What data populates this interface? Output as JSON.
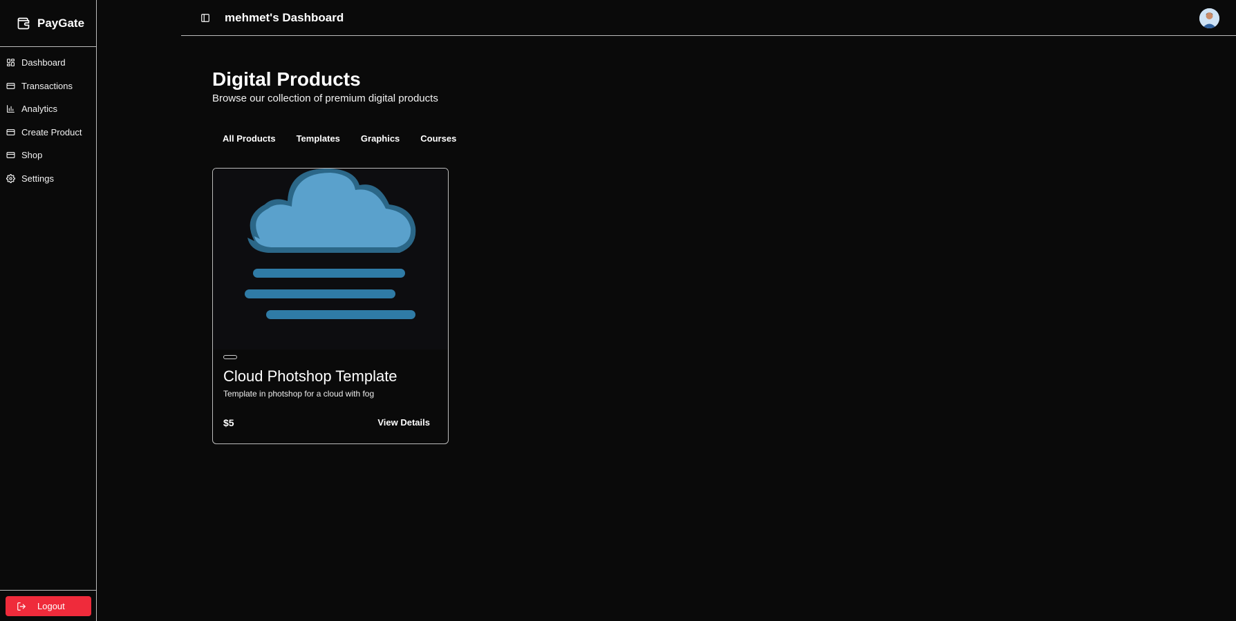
{
  "brand": {
    "name": "PayGate",
    "icon": "wallet-icon"
  },
  "sidebar": {
    "items": [
      {
        "label": "Dashboard",
        "icon": "grid-icon"
      },
      {
        "label": "Transactions",
        "icon": "credit-card-icon"
      },
      {
        "label": "Analytics",
        "icon": "bar-chart-icon"
      },
      {
        "label": "Create Product",
        "icon": "credit-card-icon"
      },
      {
        "label": "Shop",
        "icon": "credit-card-icon"
      },
      {
        "label": "Settings",
        "icon": "gear-icon"
      }
    ],
    "logout_label": "Logout"
  },
  "header": {
    "title": "mehmet's Dashboard"
  },
  "main": {
    "title": "Digital Products",
    "subtitle": "Browse our collection of premium digital products",
    "tabs": [
      {
        "label": "All Products"
      },
      {
        "label": "Templates"
      },
      {
        "label": "Graphics"
      },
      {
        "label": "Courses"
      }
    ],
    "products": [
      {
        "title": "Cloud Photshop Template",
        "description": "Template in photshop for a cloud with fog",
        "price": "$5",
        "action_label": "View Details",
        "image": "cloud-fog-illustration"
      }
    ]
  },
  "colors": {
    "background": "#0a0a0a",
    "border": "#bdbdbd",
    "logout": "#ef2b3b",
    "cloud": "#5aa1cc",
    "cloud_outline": "#2b6788"
  }
}
